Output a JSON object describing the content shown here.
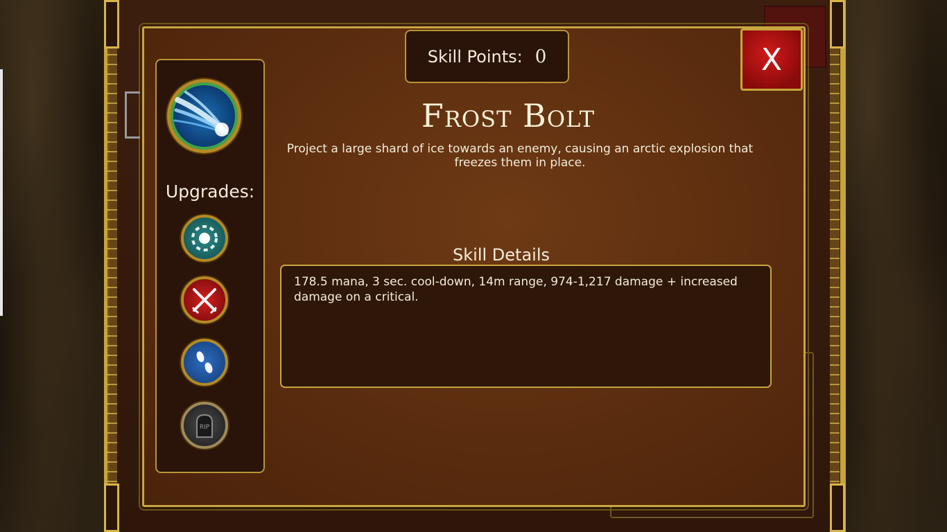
{
  "header": {
    "skill_points_label": "Skill Points:",
    "skill_points_value": "0",
    "close_label": "X"
  },
  "skill": {
    "name": "Frost Bolt",
    "description": "Project a large shard of ice towards an enemy, causing an arctic explosion that freezes them in place.",
    "icon": "frost-bolt-icon"
  },
  "sidebar": {
    "upgrades_label": "Upgrades:",
    "upgrades": [
      {
        "icon": "dotted-ring-icon",
        "color": "#1e6e6c"
      },
      {
        "icon": "crossed-swords-icon",
        "color": "#b81414"
      },
      {
        "icon": "footprints-icon",
        "color": "#1f58a8"
      },
      {
        "icon": "rip-tombstone-icon",
        "color": "#333333"
      }
    ]
  },
  "details": {
    "heading": "Skill Details",
    "text": "178.5 mana, 3 sec. cool-down, 14m range, 974-1,217 damage + increased damage on a critical."
  },
  "theme": {
    "gold": "#c7a640",
    "panel_brown": "#5a2c0e",
    "close_red": "#b81414"
  }
}
